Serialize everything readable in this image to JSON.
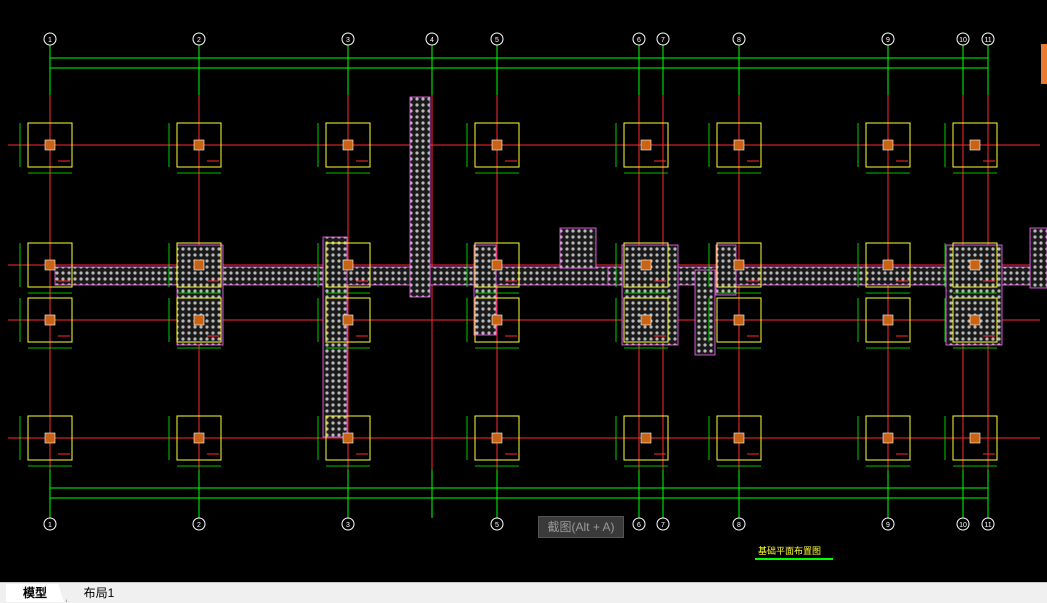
{
  "drawing": {
    "axes_top": [
      "1",
      "2",
      "3",
      "4",
      "5",
      "6",
      "7",
      "8",
      "9",
      "10",
      "11"
    ],
    "axes_bottom": [
      "1",
      "2",
      "3",
      "5",
      "6",
      "7",
      "8",
      "9",
      "10",
      "11"
    ],
    "title": "基础平面布置图",
    "colors": {
      "background": "#000000",
      "axis": "#ff2a2a",
      "dim": "#00ff00",
      "footing": "#ffff33",
      "hatch": "#d0d0d0",
      "pile": "#ff66ff"
    }
  },
  "tooltip": {
    "screenshot_hint": "截图(Alt + A)"
  },
  "layout_tabs": [
    {
      "label": "模型"
    },
    {
      "label": "布局1"
    }
  ]
}
